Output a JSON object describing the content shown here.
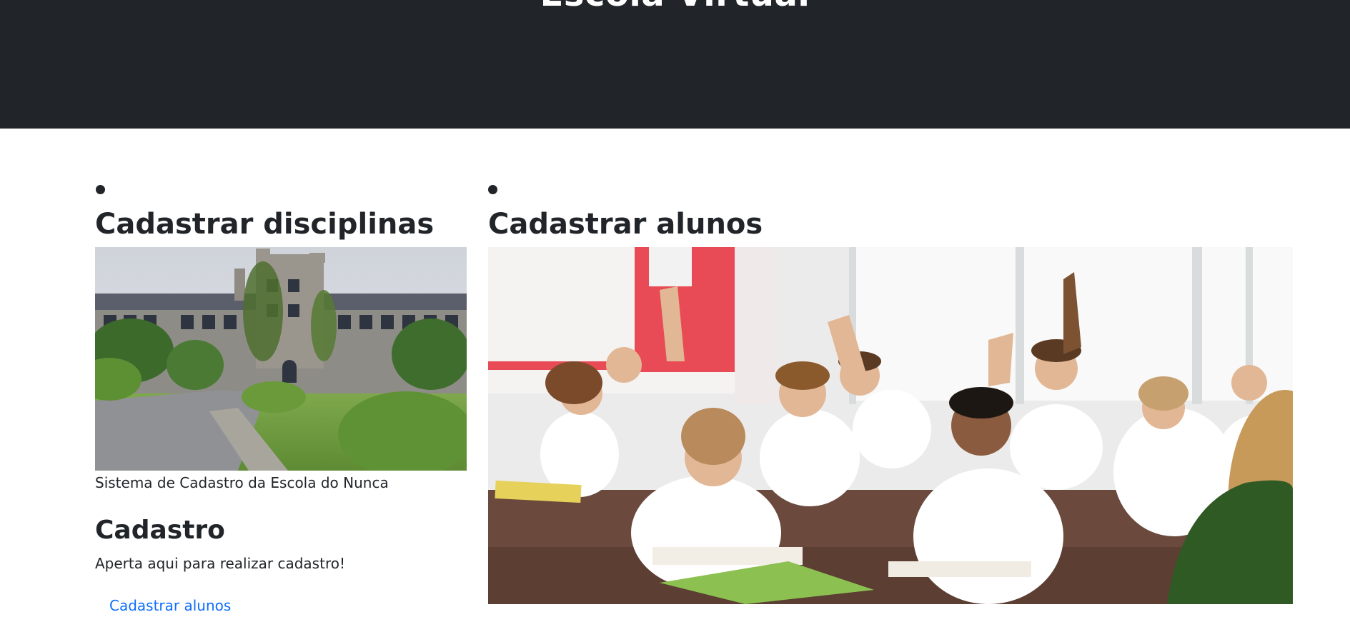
{
  "header": {
    "title": "Escola Virtual"
  },
  "left_column": {
    "title": "Cadastrar disciplinas",
    "image": "school-building-photo",
    "caption": "Sistema de Cadastro da Escola do Nunca",
    "section": {
      "title": "Cadastro",
      "text": "Aperta aqui para realizar cadastro!",
      "link_label": "Cadastrar alunos"
    }
  },
  "right_column": {
    "title": "Cadastrar alunos",
    "image": "classroom-students-photo"
  },
  "colors": {
    "header_bg": "#212529",
    "header_text": "#ffffff",
    "body_text": "#212529",
    "link": "#0d6efd"
  }
}
